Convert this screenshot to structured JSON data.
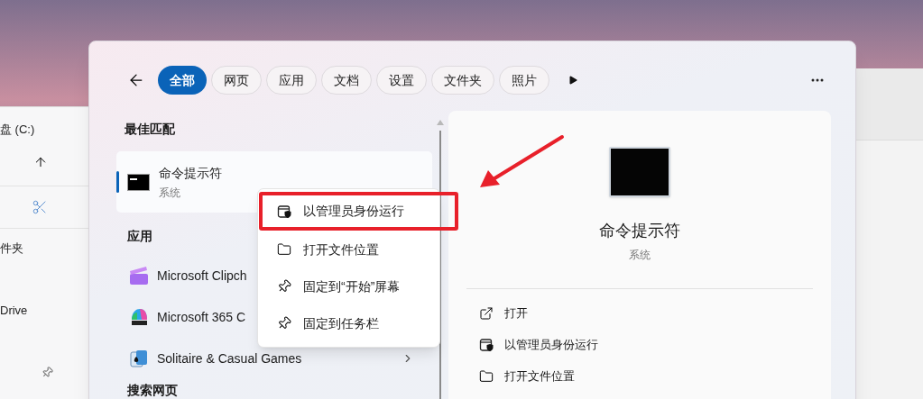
{
  "explorer": {
    "drive": "盘 (C:)",
    "items": [
      "件夹",
      "Drive"
    ]
  },
  "search": {
    "tabs": [
      {
        "label": "全部",
        "selected": true
      },
      {
        "label": "网页",
        "selected": false
      },
      {
        "label": "应用",
        "selected": false
      },
      {
        "label": "文档",
        "selected": false
      },
      {
        "label": "设置",
        "selected": false
      },
      {
        "label": "文件夹",
        "selected": false
      },
      {
        "label": "照片",
        "selected": false
      }
    ],
    "best_match": {
      "heading": "最佳匹配",
      "item": {
        "name": "命令提示符",
        "subtitle": "系统",
        "selected": true
      }
    },
    "apps": {
      "heading": "应用",
      "items": [
        {
          "name": "Microsoft Clipch",
          "kind": "clipchamp"
        },
        {
          "name": "Microsoft 365 C",
          "kind": "m365"
        },
        {
          "name": "Solitaire & Casual Games",
          "kind": "solitaire",
          "has_submenu": true
        }
      ]
    },
    "web_heading": "搜索网页",
    "detail": {
      "name": "命令提示符",
      "subtitle": "系统",
      "actions": [
        {
          "label": "打开",
          "kind": "open"
        },
        {
          "label": "以管理员身份运行",
          "kind": "admin"
        },
        {
          "label": "打开文件位置",
          "kind": "folder"
        }
      ]
    }
  },
  "context_menu": {
    "items": [
      {
        "label": "以管理员身份运行",
        "kind": "admin",
        "annotated": true
      },
      {
        "label": "打开文件位置",
        "kind": "folder",
        "annotated": false
      },
      {
        "label": "固定到“开始”屏幕",
        "kind": "pin",
        "annotated": false
      },
      {
        "label": "固定到任务栏",
        "kind": "pin",
        "annotated": false
      }
    ]
  }
}
